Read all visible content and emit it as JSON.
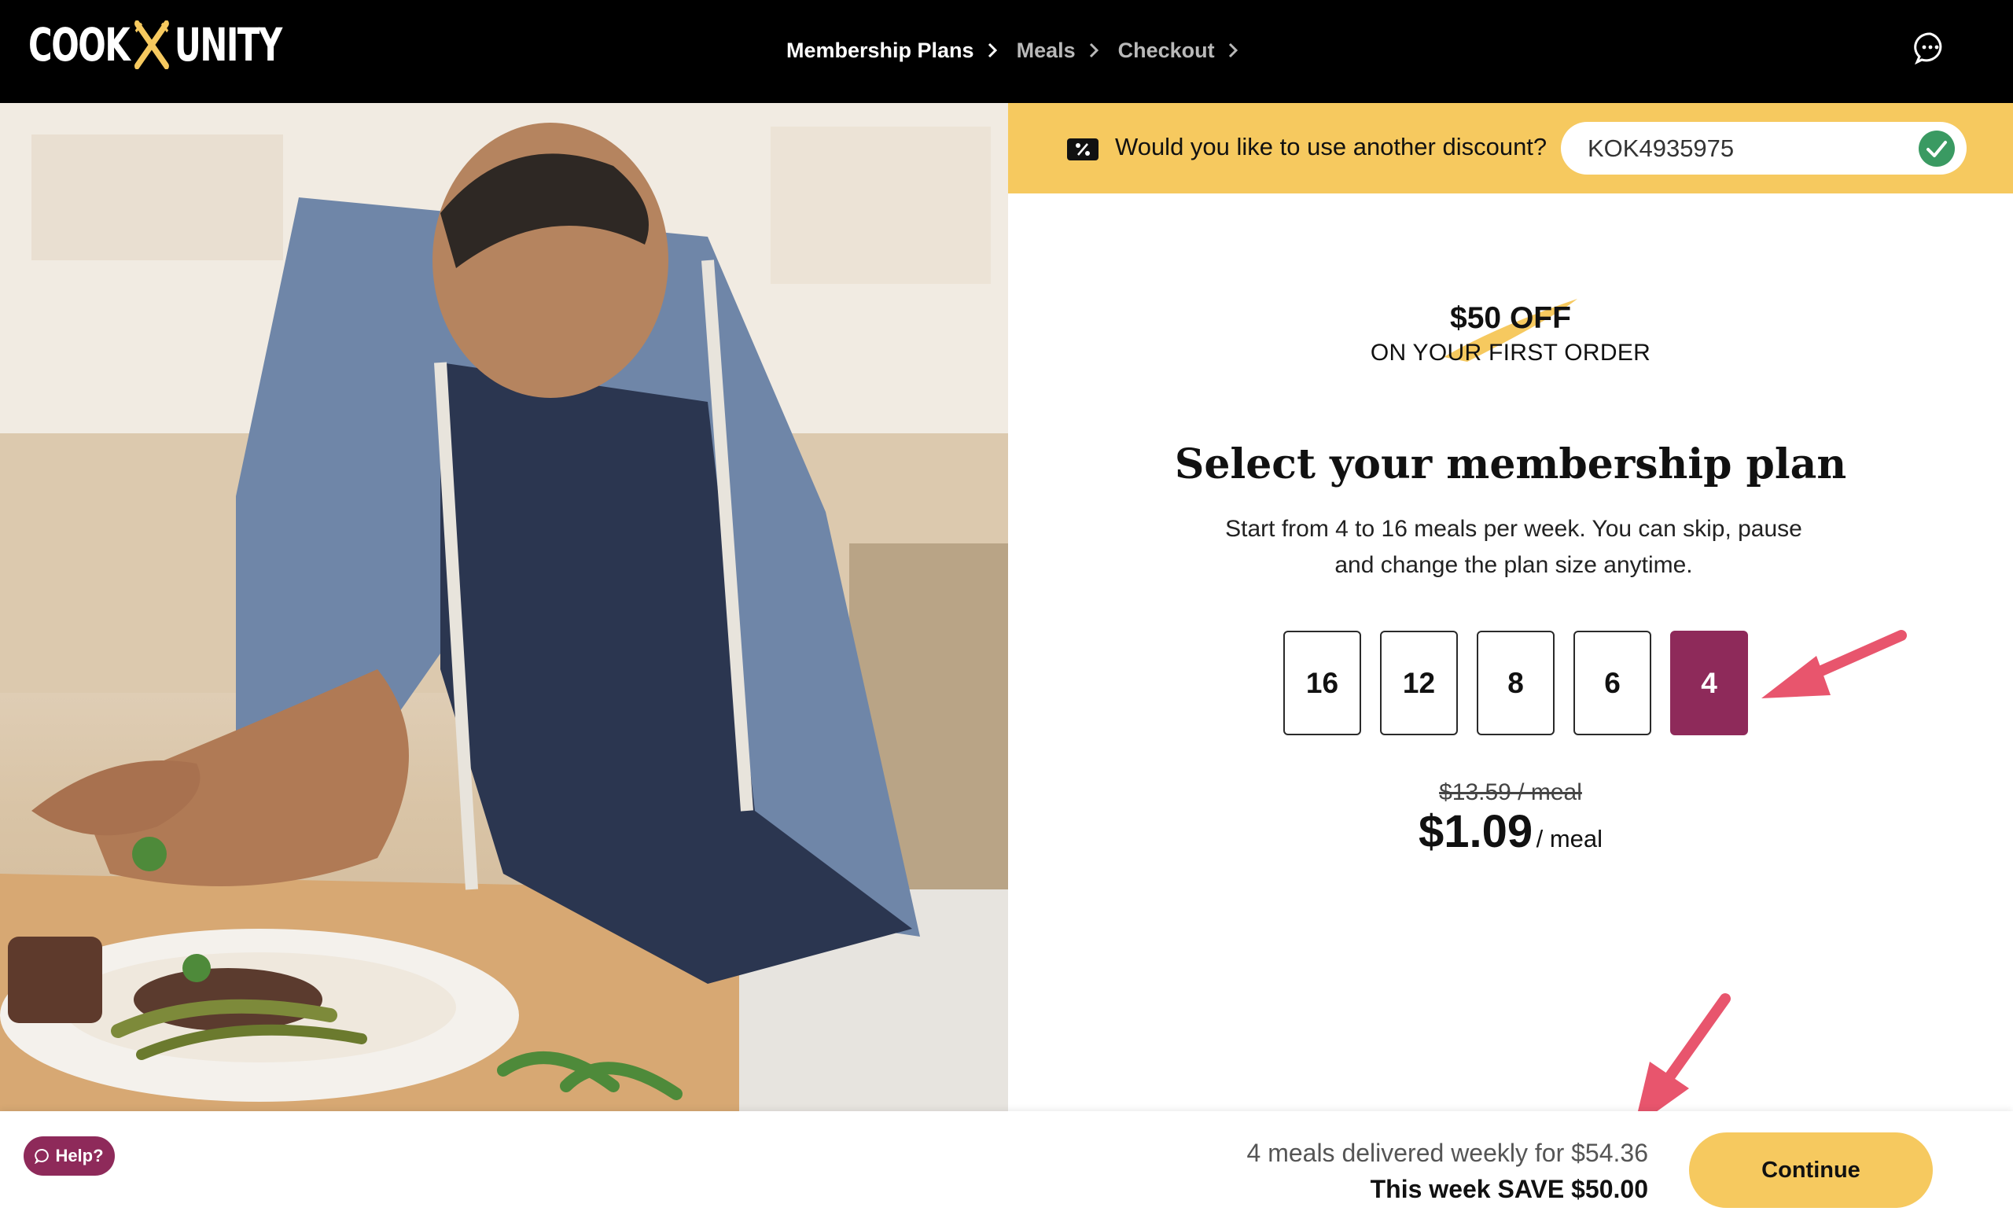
{
  "header": {
    "logo_left": "COOK",
    "logo_right": "UNITY",
    "breadcrumbs": [
      {
        "label": "Membership Plans",
        "active": true
      },
      {
        "label": "Meals",
        "active": false
      },
      {
        "label": "Checkout",
        "active": false
      }
    ],
    "chat_icon": "chat-bubble-icon"
  },
  "discount": {
    "icon": "percent-tag-icon",
    "question": "Would you like to use another discount?",
    "code_value": "KOK4935975",
    "valid_icon": "check-circle-icon"
  },
  "promo": {
    "amount": "$50 OFF",
    "subtitle": "ON YOUR FIRST ORDER"
  },
  "plan": {
    "title": "Select your membership plan",
    "description": "Start from 4 to 16 meals per week. You can skip, pause and change the plan size anytime.",
    "sizes": [
      "16",
      "12",
      "8",
      "6",
      "4"
    ],
    "selected": "4",
    "old_price": "$13.59 / meal",
    "price": "$1.09",
    "price_unit": "/ meal"
  },
  "footer": {
    "help_label": "Help?",
    "summary_line1": "4 meals delivered weekly for $54.36",
    "summary_line2": "This week SAVE $50.00",
    "continue_label": "Continue"
  },
  "colors": {
    "brand_yellow": "#f6c95f",
    "selected_plum": "#8e2a5a",
    "annotation_arrow": "#e8556d",
    "check_green": "#3a9a62"
  }
}
